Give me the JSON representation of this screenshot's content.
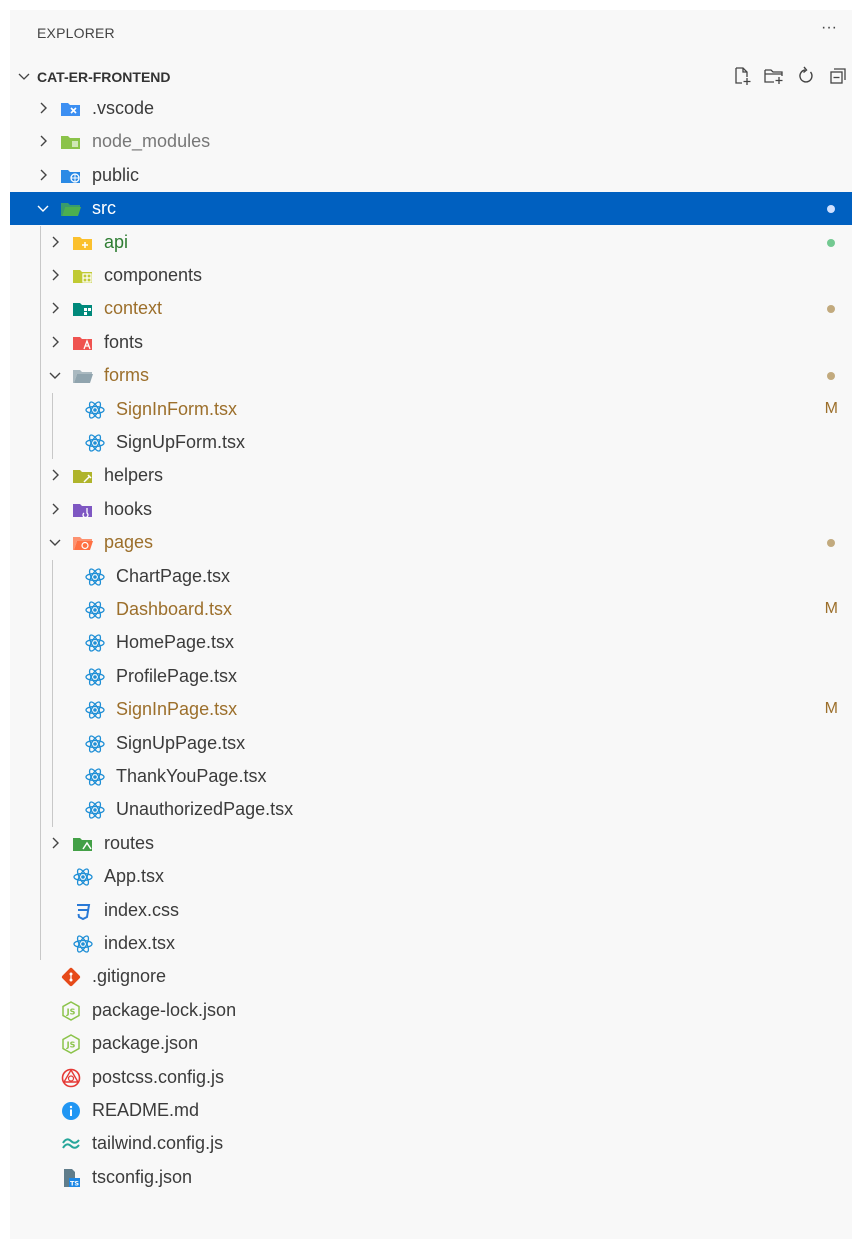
{
  "panel": {
    "title": "EXPLORER",
    "more_label": "···",
    "project": "CAT-ER-FRONTEND"
  },
  "actions": [
    {
      "name": "new-file-icon"
    },
    {
      "name": "new-folder-icon"
    },
    {
      "name": "refresh-icon"
    },
    {
      "name": "collapse-all-icon"
    }
  ],
  "colors": {
    "selection": "#0060c0",
    "modified": "#9c6f2b",
    "untracked": "#73c991",
    "react": "#1f8fd6"
  },
  "tree": [
    {
      "label": ".vscode",
      "depth": 0,
      "kind": "folder",
      "expanded": false,
      "icon": "folder-vscode",
      "color": "#3c8ff2"
    },
    {
      "label": "node_modules",
      "depth": 0,
      "kind": "folder",
      "expanded": false,
      "icon": "folder-node",
      "color": "#8bc34a",
      "textColor": "#777777"
    },
    {
      "label": "public",
      "depth": 0,
      "kind": "folder",
      "expanded": false,
      "icon": "folder-public",
      "color": "#2b8ae5"
    },
    {
      "label": "src",
      "depth": 0,
      "kind": "folder",
      "expanded": true,
      "icon": "folder-src",
      "color": "#4caf50",
      "selected": true,
      "dot": "#cfe0ff"
    },
    {
      "label": "api",
      "depth": 1,
      "kind": "folder",
      "expanded": false,
      "icon": "folder-api",
      "color": "#fbc02d",
      "textColor": "#2e7d32",
      "dot": "#73c991"
    },
    {
      "label": "components",
      "depth": 1,
      "kind": "folder",
      "expanded": false,
      "icon": "folder-components",
      "color": "#c0ca33"
    },
    {
      "label": "context",
      "depth": 1,
      "kind": "folder",
      "expanded": false,
      "icon": "folder-context",
      "color": "#00897b",
      "textColor": "#9c6f2b",
      "dot": "#c2aa7e"
    },
    {
      "label": "fonts",
      "depth": 1,
      "kind": "folder",
      "expanded": false,
      "icon": "folder-fonts",
      "color": "#ef5350"
    },
    {
      "label": "forms",
      "depth": 1,
      "kind": "folder",
      "expanded": true,
      "icon": "folder-forms",
      "color": "#90a4ae",
      "textColor": "#9c6f2b",
      "dot": "#c2aa7e"
    },
    {
      "label": "SignInForm.tsx",
      "depth": 2,
      "kind": "react",
      "textColor": "#9c6f2b",
      "status": "M"
    },
    {
      "label": "SignUpForm.tsx",
      "depth": 2,
      "kind": "react"
    },
    {
      "label": "helpers",
      "depth": 1,
      "kind": "folder",
      "expanded": false,
      "icon": "folder-helpers",
      "color": "#afb42b"
    },
    {
      "label": "hooks",
      "depth": 1,
      "kind": "folder",
      "expanded": false,
      "icon": "folder-hooks",
      "color": "#7e57c2"
    },
    {
      "label": "pages",
      "depth": 1,
      "kind": "folder",
      "expanded": true,
      "icon": "folder-pages",
      "color": "#ff7043",
      "textColor": "#9c6f2b",
      "dot": "#c2aa7e"
    },
    {
      "label": "ChartPage.tsx",
      "depth": 2,
      "kind": "react"
    },
    {
      "label": "Dashboard.tsx",
      "depth": 2,
      "kind": "react",
      "textColor": "#9c6f2b",
      "status": "M"
    },
    {
      "label": "HomePage.tsx",
      "depth": 2,
      "kind": "react"
    },
    {
      "label": "ProfilePage.tsx",
      "depth": 2,
      "kind": "react"
    },
    {
      "label": "SignInPage.tsx",
      "depth": 2,
      "kind": "react",
      "textColor": "#9c6f2b",
      "status": "M"
    },
    {
      "label": "SignUpPage.tsx",
      "depth": 2,
      "kind": "react"
    },
    {
      "label": "ThankYouPage.tsx",
      "depth": 2,
      "kind": "react"
    },
    {
      "label": "UnauthorizedPage.tsx",
      "depth": 2,
      "kind": "react"
    },
    {
      "label": "routes",
      "depth": 1,
      "kind": "folder",
      "expanded": false,
      "icon": "folder-routes",
      "color": "#43a047"
    },
    {
      "label": "App.tsx",
      "depth": 1,
      "kind": "react"
    },
    {
      "label": "index.css",
      "depth": 1,
      "kind": "css"
    },
    {
      "label": "index.tsx",
      "depth": 1,
      "kind": "react"
    },
    {
      "label": ".gitignore",
      "depth": 0,
      "kind": "git"
    },
    {
      "label": "package-lock.json",
      "depth": 0,
      "kind": "nodejs"
    },
    {
      "label": "package.json",
      "depth": 0,
      "kind": "nodejs"
    },
    {
      "label": "postcss.config.js",
      "depth": 0,
      "kind": "postcss"
    },
    {
      "label": "README.md",
      "depth": 0,
      "kind": "info"
    },
    {
      "label": "tailwind.config.js",
      "depth": 0,
      "kind": "tailwind"
    },
    {
      "label": "tsconfig.json",
      "depth": 0,
      "kind": "tsconfig"
    }
  ]
}
